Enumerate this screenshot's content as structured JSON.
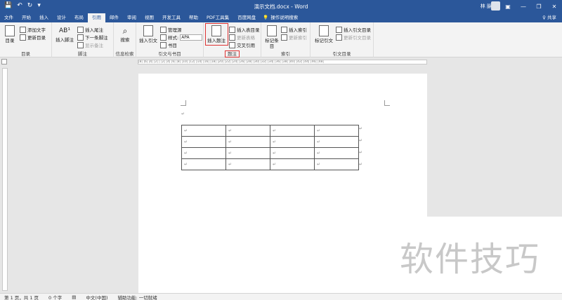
{
  "window": {
    "title": "演示文档.docx  -  Word",
    "user": "林 脉",
    "minimize": "—",
    "restore": "❐",
    "close": "✕",
    "ribbon_opts": "▣"
  },
  "qat": {
    "save": "💾",
    "undo": "↶",
    "redo": "↻",
    "customize": "▾"
  },
  "tabs": [
    "文件",
    "开始",
    "插入",
    "设计",
    "布局",
    "引用",
    "邮件",
    "审阅",
    "视图",
    "开发工具",
    "帮助",
    "PDF工具集",
    "百度网盘"
  ],
  "active_tab": "引用",
  "tell_me": "操作说明搜索",
  "share": "♀ 共享",
  "ribbon": {
    "toc": {
      "big": "目录",
      "add_text": "添加文字",
      "update": "更新目录",
      "label": "目录"
    },
    "footnotes": {
      "big": "插入脚注",
      "insert_endnote": "插入尾注",
      "next_footnote": "下一条脚注",
      "show_notes": "显示备注",
      "label": "脚注",
      "big_icon": "AB¹"
    },
    "research": {
      "big": "搜索",
      "label": "信息检索"
    },
    "citations": {
      "big": "插入引文",
      "manage": "管理源",
      "style_label": "样式:",
      "style_value": "APA",
      "bibliography": "书目",
      "label": "引文与书目"
    },
    "captions": {
      "big": "插入题注",
      "insert_tof": "插入表目录",
      "update_table": "更新表格",
      "cross_ref": "交叉引用",
      "label": "题注"
    },
    "index": {
      "big": "标记条目",
      "insert_index": "插入索引",
      "update_index": "更新索引",
      "label": "索引"
    },
    "toa": {
      "big": "标记引文",
      "insert_toa": "插入引文目录",
      "update_toa": "更新引文目录",
      "label": "引文目录"
    }
  },
  "ruler": "|8| |6| |4| |2| | |2| |4| |6| |8| |10| |12| |14| |16| |18| |20| |22| |24| |26| |28| |30| |32| |34| |36| |38| |40| |42| |44| |46| |48|",
  "doc": {
    "para_mark": "↵",
    "table": [
      [
        "↵",
        "↵",
        "↵",
        "↵"
      ],
      [
        "↵",
        "↵",
        "↵",
        "↵"
      ],
      [
        "↵",
        "↵",
        "↵",
        "↵"
      ],
      [
        "↵",
        "↵",
        "↵",
        "↵"
      ]
    ]
  },
  "watermark": "软件技巧",
  "status": {
    "page": "第 1 页，共 1 页",
    "words": "0 个字",
    "lang": "中文(中国)",
    "a11y": "辅助功能: 一切就绪"
  }
}
